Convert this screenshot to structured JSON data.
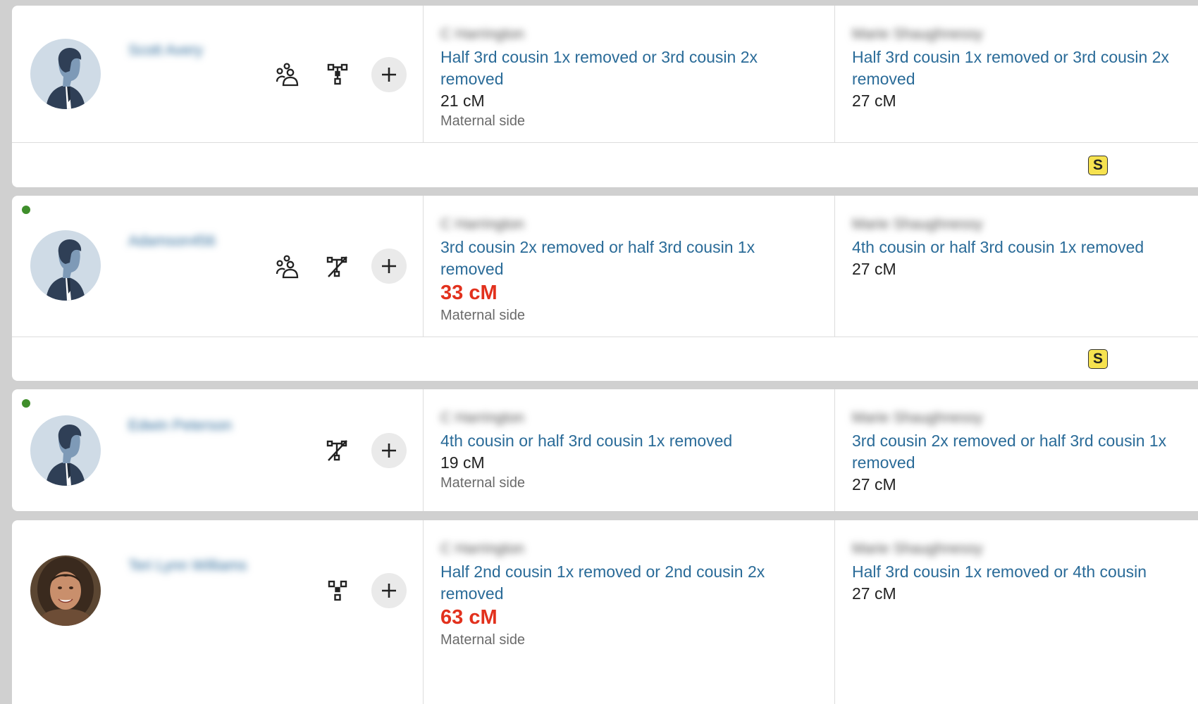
{
  "matches": [
    {
      "name": "Scott Avery",
      "online": false,
      "avatar": "silhouette-avatar",
      "icons": [
        "shared-matches-icon",
        "tree-icon"
      ],
      "col1": {
        "person": "C Harrington",
        "relationship": "Half 3rd cousin 1x removed or 3rd cousin 2x removed",
        "cm": "21 cM",
        "side": "Maternal side"
      },
      "col2": {
        "person": "Marie Shaughnessy",
        "relationship": "Half 3rd cousin 1x removed or 3rd cousin 2x removed",
        "cm": "27 cM"
      },
      "badge": "S"
    },
    {
      "name": "Adamson456",
      "online": true,
      "avatar": "silhouette-avatar",
      "icons": [
        "shared-matches-icon",
        "no-tree-icon"
      ],
      "col1": {
        "person": "C Harrington",
        "relationship": "3rd cousin 2x removed or half 3rd cousin 1x removed",
        "cm": "33 cM",
        "side": "Maternal side"
      },
      "col2": {
        "person": "Marie Shaughnessy",
        "relationship": "4th cousin or half 3rd cousin 1x removed",
        "cm": "27 cM"
      },
      "badge": "S"
    },
    {
      "name": "Edwin Peterson",
      "online": true,
      "avatar": "silhouette-avatar",
      "icons": [
        "no-tree-icon"
      ],
      "col1": {
        "person": "C Harrington",
        "relationship": "4th cousin or half 3rd cousin 1x removed",
        "cm": "19 cM",
        "side": "Maternal side"
      },
      "col2": {
        "person": "Marie Shaughnessy",
        "relationship": "3rd cousin 2x removed or half 3rd cousin 1x removed",
        "cm": "27 cM"
      }
    },
    {
      "name": "Teri Lynn Williams",
      "online": false,
      "avatar": "photo-avatar",
      "icons": [
        "private-tree-icon"
      ],
      "col1": {
        "person": "C Harrington",
        "relationship": "Half 2nd cousin 1x removed or 2nd cousin 2x removed",
        "cm": "63 cM",
        "side": "Maternal side"
      },
      "col2": {
        "person": "Marie Shaughnessy",
        "relationship": "Half 3rd cousin 1x removed or 4th cousin",
        "cm": "27 cM"
      }
    }
  ],
  "add_icon": "plus-icon",
  "colors": {
    "link": "#2a6b98",
    "highlight_cm": "#e2311d",
    "online_dot": "#3f8e2b",
    "badge": "#f6e24f",
    "background": "#d0d0d0"
  }
}
